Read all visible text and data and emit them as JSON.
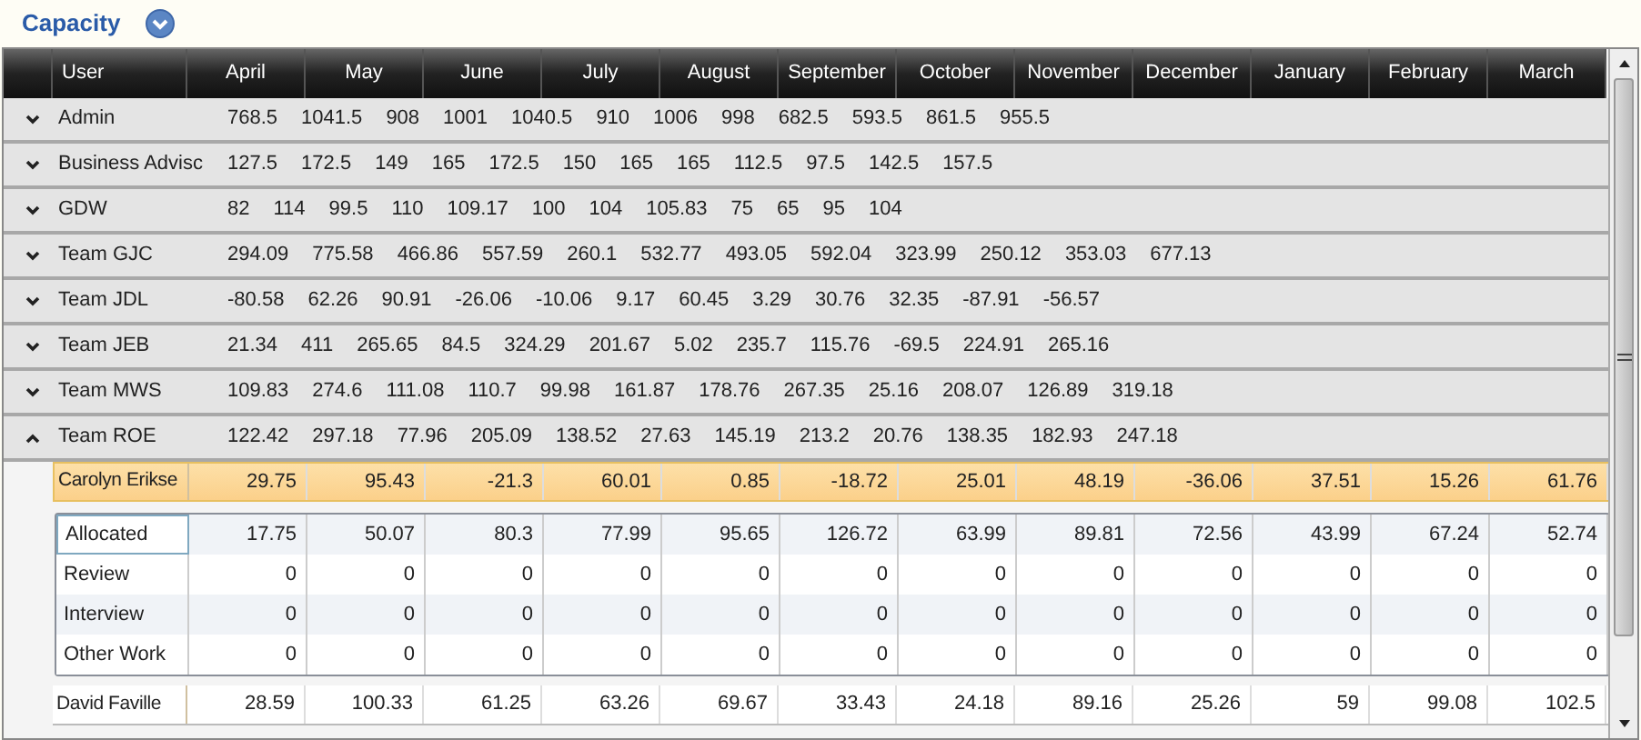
{
  "title": "Capacity",
  "columns": [
    "User",
    "April",
    "May",
    "June",
    "July",
    "August",
    "September",
    "October",
    "November",
    "December",
    "January",
    "February",
    "March"
  ],
  "groups": [
    {
      "name": "Admin",
      "expanded": false,
      "values": [
        "768.5",
        "1041.5",
        "908",
        "1001",
        "1040.5",
        "910",
        "1006",
        "998",
        "682.5",
        "593.5",
        "861.5",
        "955.5"
      ]
    },
    {
      "name": "Business Advisc",
      "expanded": false,
      "values": [
        "127.5",
        "172.5",
        "149",
        "165",
        "172.5",
        "150",
        "165",
        "165",
        "112.5",
        "97.5",
        "142.5",
        "157.5"
      ]
    },
    {
      "name": "GDW",
      "expanded": false,
      "values": [
        "82",
        "114",
        "99.5",
        "110",
        "109.17",
        "100",
        "104",
        "105.83",
        "75",
        "65",
        "95",
        "104"
      ]
    },
    {
      "name": "Team GJC",
      "expanded": false,
      "values": [
        "294.09",
        "775.58",
        "466.86",
        "557.59",
        "260.1",
        "532.77",
        "493.05",
        "592.04",
        "323.99",
        "250.12",
        "353.03",
        "677.13"
      ]
    },
    {
      "name": "Team JDL",
      "expanded": false,
      "values": [
        "-80.58",
        "62.26",
        "90.91",
        "-26.06",
        "-10.06",
        "9.17",
        "60.45",
        "3.29",
        "30.76",
        "32.35",
        "-87.91",
        "-56.57"
      ]
    },
    {
      "name": "Team JEB",
      "expanded": false,
      "values": [
        "21.34",
        "411",
        "265.65",
        "84.5",
        "324.29",
        "201.67",
        "5.02",
        "235.7",
        "115.76",
        "-69.5",
        "224.91",
        "265.16"
      ]
    },
    {
      "name": "Team MWS",
      "expanded": false,
      "values": [
        "109.83",
        "274.6",
        "111.08",
        "110.7",
        "99.98",
        "161.87",
        "178.76",
        "267.35",
        "25.16",
        "208.07",
        "126.89",
        "319.18"
      ]
    },
    {
      "name": "Team ROE",
      "expanded": true,
      "values": [
        "122.42",
        "297.18",
        "77.96",
        "205.09",
        "138.52",
        "27.63",
        "145.19",
        "213.2",
        "20.76",
        "138.35",
        "182.93",
        "247.18"
      ],
      "members": [
        {
          "name": "Carolyn Erikse",
          "selected": true,
          "values": [
            "29.75",
            "95.43",
            "-21.3",
            "60.01",
            "0.85",
            "-18.72",
            "25.01",
            "48.19",
            "-36.06",
            "37.51",
            "15.26",
            "61.76"
          ],
          "details": [
            {
              "name": "Allocated",
              "selected": true,
              "values": [
                "17.75",
                "50.07",
                "80.3",
                "77.99",
                "95.65",
                "126.72",
                "63.99",
                "89.81",
                "72.56",
                "43.99",
                "67.24",
                "52.74"
              ]
            },
            {
              "name": "Review",
              "selected": false,
              "values": [
                "0",
                "0",
                "0",
                "0",
                "0",
                "0",
                "0",
                "0",
                "0",
                "0",
                "0",
                "0"
              ]
            },
            {
              "name": "Interview",
              "selected": false,
              "values": [
                "0",
                "0",
                "0",
                "0",
                "0",
                "0",
                "0",
                "0",
                "0",
                "0",
                "0",
                "0"
              ]
            },
            {
              "name": "Other Work",
              "selected": false,
              "values": [
                "0",
                "0",
                "0",
                "0",
                "0",
                "0",
                "0",
                "0",
                "0",
                "0",
                "0",
                "0"
              ]
            }
          ]
        },
        {
          "name": "David Faville",
          "selected": false,
          "values": [
            "28.59",
            "100.33",
            "61.25",
            "63.26",
            "69.67",
            "33.43",
            "24.18",
            "89.16",
            "25.26",
            "59",
            "99.08",
            "102.5"
          ]
        }
      ]
    }
  ]
}
